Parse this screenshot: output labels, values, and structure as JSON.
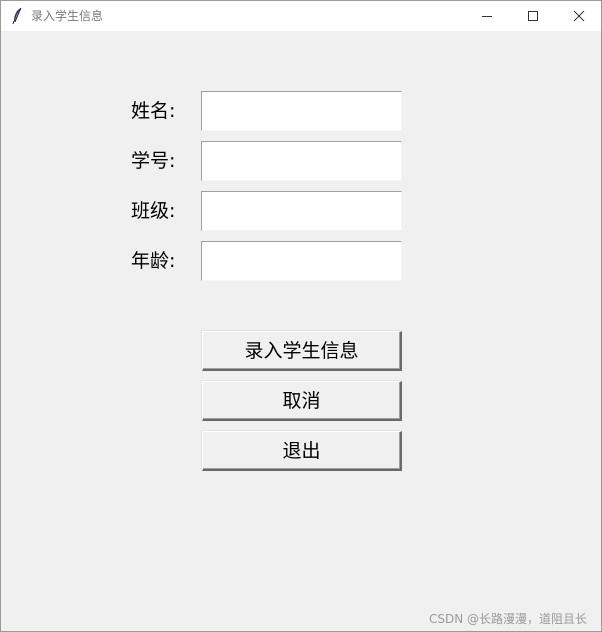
{
  "window": {
    "title": "录入学生信息",
    "icon": "feather-icon",
    "controls": [
      "minimize-icon",
      "maximize-icon",
      "close-icon"
    ]
  },
  "form": {
    "fields": [
      {
        "label": "姓名:",
        "value": ""
      },
      {
        "label": "学号:",
        "value": ""
      },
      {
        "label": "班级:",
        "value": ""
      },
      {
        "label": "年龄:",
        "value": ""
      }
    ]
  },
  "actions": {
    "submit_label": "录入学生信息",
    "cancel_label": "取消",
    "exit_label": "退出"
  },
  "watermark": "CSDN @长路漫漫，道阻且长"
}
